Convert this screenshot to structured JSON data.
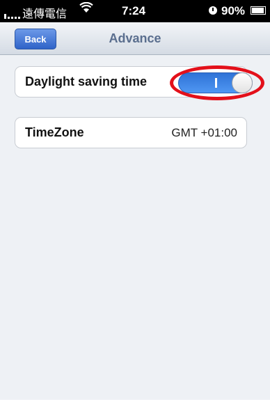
{
  "status_bar": {
    "carrier": "遠傳電信",
    "wifi_icon": "wifi-icon",
    "time": "7:24",
    "battery_percent": "90%",
    "battery_icon": "battery-icon"
  },
  "nav_bar": {
    "back_label": "Back",
    "title": "Advance"
  },
  "settings": {
    "daylight_saving": {
      "label": "Daylight saving time",
      "enabled": true,
      "toggle_on_mark": "I"
    },
    "timezone": {
      "label": "TimeZone",
      "value": "GMT +01:00"
    }
  },
  "colors": {
    "toggle_on": "#3a82e6",
    "annotation": "#e3101a",
    "back_button": "#3f72d4"
  }
}
